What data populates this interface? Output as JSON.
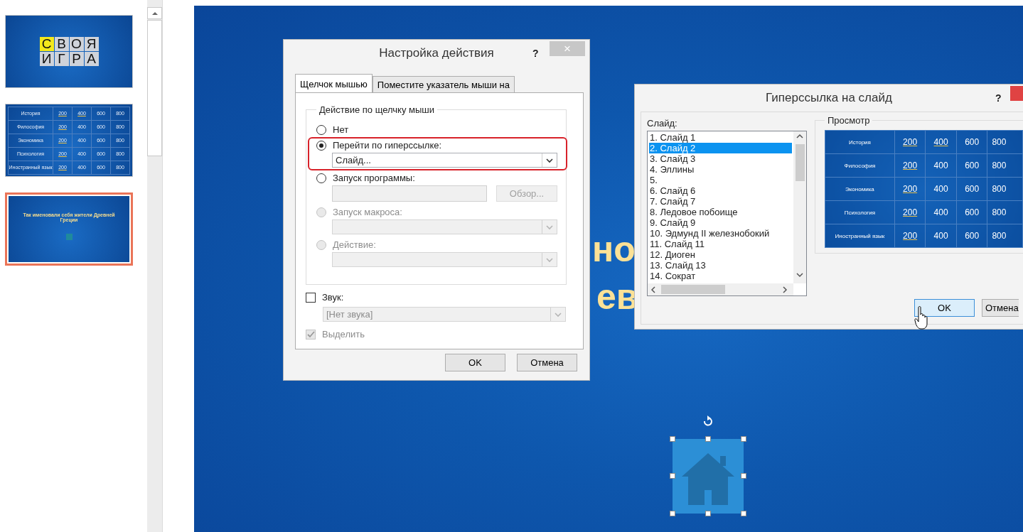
{
  "thumbnails": [
    {
      "kind": "title",
      "selected": false,
      "tiles": [
        {
          "letter": "С",
          "highlighted": true
        },
        {
          "letter": "В",
          "highlighted": false
        },
        {
          "letter": "О",
          "highlighted": false
        },
        {
          "letter": "Я",
          "highlighted": false
        },
        {
          "letter": "И",
          "highlighted": false
        },
        {
          "letter": "Г",
          "highlighted": false
        },
        {
          "letter": "Р",
          "highlighted": false
        },
        {
          "letter": "А",
          "highlighted": false
        }
      ]
    },
    {
      "kind": "table",
      "selected": false,
      "rows": [
        {
          "category": "История",
          "cells": [
            {
              "text": "200",
              "underlined": true
            },
            {
              "text": "400",
              "underlined": true
            },
            {
              "text": "600",
              "underlined": false
            },
            {
              "text": "800",
              "underlined": false
            }
          ]
        },
        {
          "category": "Философия",
          "cells": [
            {
              "text": "200",
              "underlined": true
            },
            {
              "text": "400",
              "underlined": false
            },
            {
              "text": "600",
              "underlined": false
            },
            {
              "text": "800",
              "underlined": false
            }
          ]
        },
        {
          "category": "Экономика",
          "cells": [
            {
              "text": "200",
              "underlined": true
            },
            {
              "text": "400",
              "underlined": false
            },
            {
              "text": "600",
              "underlined": false
            },
            {
              "text": "800",
              "underlined": false
            }
          ]
        },
        {
          "category": "Психология",
          "cells": [
            {
              "text": "200",
              "underlined": true
            },
            {
              "text": "400",
              "underlined": false
            },
            {
              "text": "600",
              "underlined": false
            },
            {
              "text": "800",
              "underlined": false
            }
          ]
        },
        {
          "category": "Иностранный язык",
          "cells": [
            {
              "text": "200",
              "underlined": true
            },
            {
              "text": "400",
              "underlined": false
            },
            {
              "text": "600",
              "underlined": false
            },
            {
              "text": "800",
              "underlined": false
            }
          ]
        }
      ]
    },
    {
      "kind": "question",
      "selected": true,
      "text": "Так именовали себя жители Древней Греции"
    }
  ],
  "slide": {
    "texts": [
      "но",
      "ев"
    ],
    "shape": {
      "kind": "home",
      "selected": true
    }
  },
  "action_dialog": {
    "title": "Настройка действия",
    "help": "?",
    "close": "×",
    "tabs": [
      {
        "label": "Щелчок мышью",
        "selected": true
      },
      {
        "label": "Поместите указатель мыши на",
        "selected": false
      }
    ],
    "group_title": "Действие по щелчку мыши",
    "choices": [
      {
        "label": "Нет",
        "selected": false,
        "disabled": false
      },
      {
        "label": "Перейти по гиперссылке:",
        "selected": true,
        "disabled": false,
        "highlighted": true,
        "field": {
          "kind": "dropdown",
          "value": "Слайд...",
          "disabled": false
        }
      },
      {
        "label": "Запуск программы:",
        "selected": false,
        "disabled": false,
        "field": {
          "kind": "text",
          "disabled": true
        },
        "button": {
          "label": "Обзор...",
          "disabled": true
        }
      },
      {
        "label": "Запуск макроса:",
        "selected": false,
        "disabled": true,
        "field": {
          "kind": "dropdown",
          "disabled": true
        }
      },
      {
        "label": "Действие:",
        "selected": false,
        "disabled": true,
        "field": {
          "kind": "dropdown",
          "disabled": true
        }
      }
    ],
    "sound": {
      "label": "Звук:",
      "checked": false,
      "disabled": false,
      "dropdown": {
        "value": "[Нет звука]",
        "disabled": true
      }
    },
    "highlight_click": {
      "label": "Выделить",
      "checked": true,
      "disabled": true
    },
    "buttons": [
      "OK",
      "Отмена"
    ]
  },
  "hyperlink_dialog": {
    "title": "Гиперссылка на слайд",
    "help": "?",
    "list_label": "Слайд:",
    "slides": [
      {
        "label": "1. Слайд 1",
        "selected": false
      },
      {
        "label": "2. Слайд 2",
        "selected": true
      },
      {
        "label": "3. Слайд 3",
        "selected": false
      },
      {
        "label": "4. Эллины",
        "selected": false
      },
      {
        "label": "5.",
        "selected": false
      },
      {
        "label": "6. Слайд 6",
        "selected": false
      },
      {
        "label": "7. Слайд 7",
        "selected": false
      },
      {
        "label": "8. Ледовое побоище",
        "selected": false
      },
      {
        "label": "9. Слайд 9",
        "selected": false
      },
      {
        "label": "10. Эдмунд II железнобокий",
        "selected": false
      },
      {
        "label": "11. Слайд 11",
        "selected": false
      },
      {
        "label": "12. Диоген",
        "selected": false
      },
      {
        "label": "13. Слайд 13",
        "selected": false
      },
      {
        "label": "14. Сократ",
        "selected": false
      }
    ],
    "preview_title": "Просмотр",
    "preview_rows": [
      {
        "category": "История",
        "cells": [
          {
            "text": "200",
            "underlined": true
          },
          {
            "text": "400",
            "underlined": true
          },
          {
            "text": "600",
            "underlined": false
          },
          {
            "text": "800",
            "underlined": false
          }
        ]
      },
      {
        "category": "Философия",
        "cells": [
          {
            "text": "200",
            "underlined": true
          },
          {
            "text": "400",
            "underlined": false
          },
          {
            "text": "600",
            "underlined": false
          },
          {
            "text": "800",
            "underlined": false
          }
        ]
      },
      {
        "category": "Экономика",
        "cells": [
          {
            "text": "200",
            "underlined": true
          },
          {
            "text": "400",
            "underlined": false
          },
          {
            "text": "600",
            "underlined": false
          },
          {
            "text": "800",
            "underlined": false
          }
        ]
      },
      {
        "category": "Психология",
        "cells": [
          {
            "text": "200",
            "underlined": true
          },
          {
            "text": "400",
            "underlined": false
          },
          {
            "text": "600",
            "underlined": false
          },
          {
            "text": "800",
            "underlined": false
          }
        ]
      },
      {
        "category": "Иностранный язык",
        "cells": [
          {
            "text": "200",
            "underlined": true
          },
          {
            "text": "400",
            "underlined": false
          },
          {
            "text": "600",
            "underlined": false
          },
          {
            "text": "800",
            "underlined": false
          }
        ]
      }
    ],
    "buttons": [
      {
        "label": "OK",
        "focused": true
      },
      {
        "label": "Отмена",
        "focused": false
      }
    ]
  }
}
